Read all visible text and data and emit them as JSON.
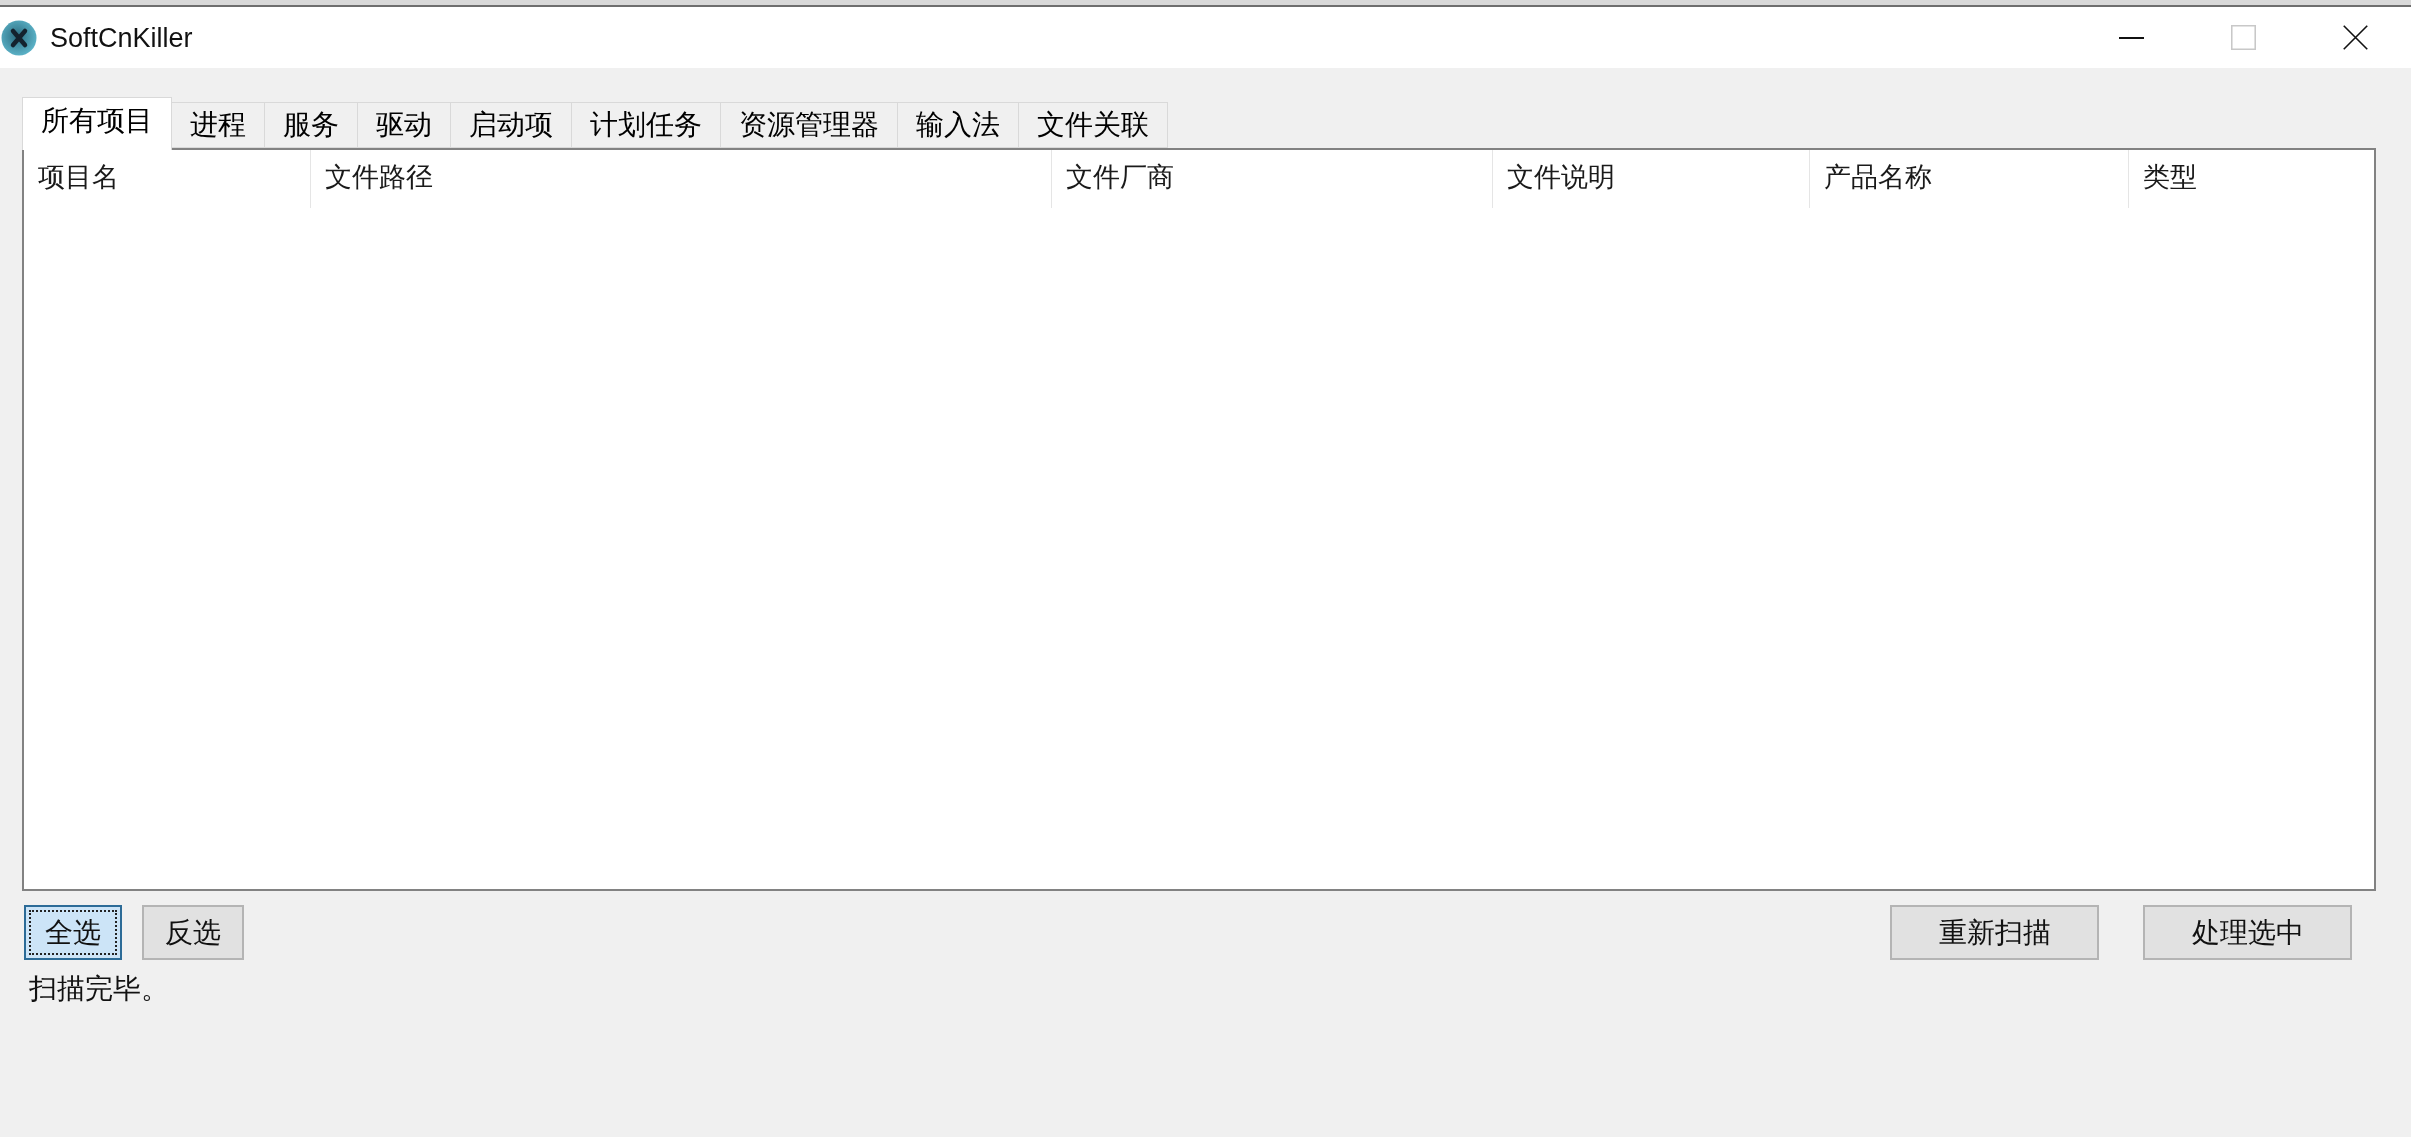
{
  "window": {
    "title": "SoftCnKiller",
    "controls": [
      {
        "kind": "minimize",
        "disabled": false
      },
      {
        "kind": "maximize",
        "disabled": true
      },
      {
        "kind": "close",
        "disabled": false
      }
    ]
  },
  "tabs": [
    {
      "label": "所有项目",
      "selected": true
    },
    {
      "label": "进程",
      "selected": false
    },
    {
      "label": "服务",
      "selected": false
    },
    {
      "label": "驱动",
      "selected": false
    },
    {
      "label": "启动项",
      "selected": false
    },
    {
      "label": "计划任务",
      "selected": false
    },
    {
      "label": "资源管理器",
      "selected": false
    },
    {
      "label": "输入法",
      "selected": false
    },
    {
      "label": "文件关联",
      "selected": false
    }
  ],
  "table": {
    "columns": [
      "项目名",
      "文件路径",
      "文件厂商",
      "文件说明",
      "产品名称",
      "类型"
    ]
  },
  "selection_buttons": [
    {
      "label": "全选",
      "focused": true
    },
    {
      "label": "反选",
      "focused": false
    }
  ],
  "action_buttons": [
    {
      "label": "重新扫描",
      "focused": false
    },
    {
      "label": "处理选中",
      "focused": false
    }
  ],
  "status_bar": {
    "text": "扫描完毕。"
  }
}
